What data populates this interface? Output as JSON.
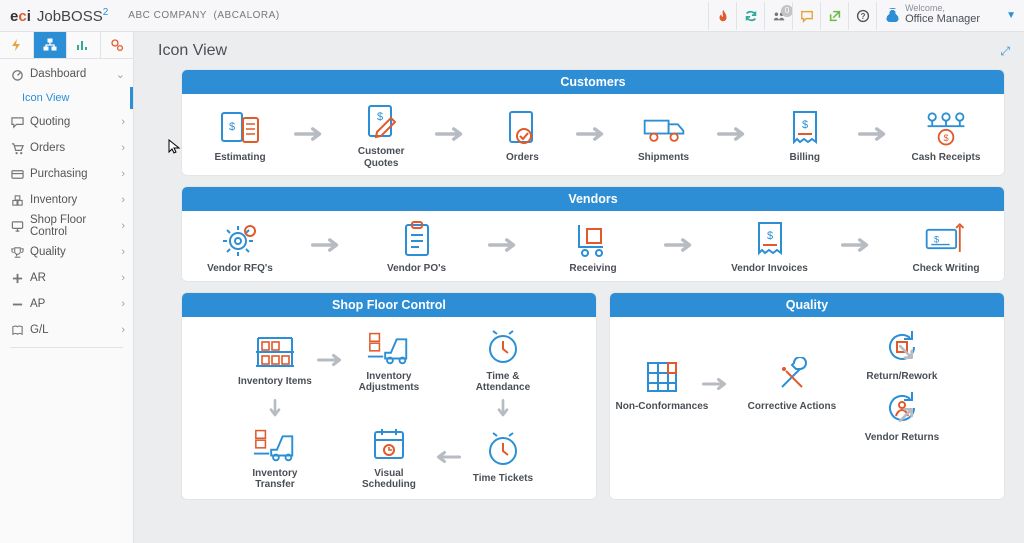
{
  "header": {
    "brand": {
      "eci_e": "e",
      "eci_c": "c",
      "eci_i": "i",
      "jobboss": "JobBOSS",
      "super": "2"
    },
    "company": "ABC COMPANY",
    "company_code": "(ABCALORA)",
    "badge_count": "0",
    "welcome_label": "Welcome,",
    "role": "Office Manager"
  },
  "sidebar": {
    "items": [
      {
        "label": "Dashboard",
        "expanded": true
      },
      {
        "label": "Quoting"
      },
      {
        "label": "Orders"
      },
      {
        "label": "Purchasing"
      },
      {
        "label": "Inventory"
      },
      {
        "label": "Shop Floor Control"
      },
      {
        "label": "Quality"
      },
      {
        "label": "AR"
      },
      {
        "label": "AP"
      },
      {
        "label": "G/L"
      }
    ],
    "sub_icon_view": "Icon View"
  },
  "page": {
    "title": "Icon View"
  },
  "customers": {
    "title": "Customers",
    "items": [
      "Estimating",
      "Customer Quotes",
      "Orders",
      "Shipments",
      "Billing",
      "Cash Receipts"
    ]
  },
  "vendors": {
    "title": "Vendors",
    "items": [
      "Vendor RFQ's",
      "Vendor PO's",
      "Receiving",
      "Vendor Invoices",
      "Check Writing"
    ]
  },
  "sfc": {
    "title": "Shop Floor Control",
    "row1": [
      "Inventory Items",
      "Inventory Adjustments",
      "Time & Attendance"
    ],
    "row2": [
      "Inventory Transfer",
      "Visual Scheduling",
      "Time Tickets"
    ]
  },
  "quality": {
    "title": "Quality",
    "left": [
      "Return/Rework",
      "Vendor Returns"
    ],
    "mid": "Non-Conformances",
    "right": "Corrective Actions"
  }
}
